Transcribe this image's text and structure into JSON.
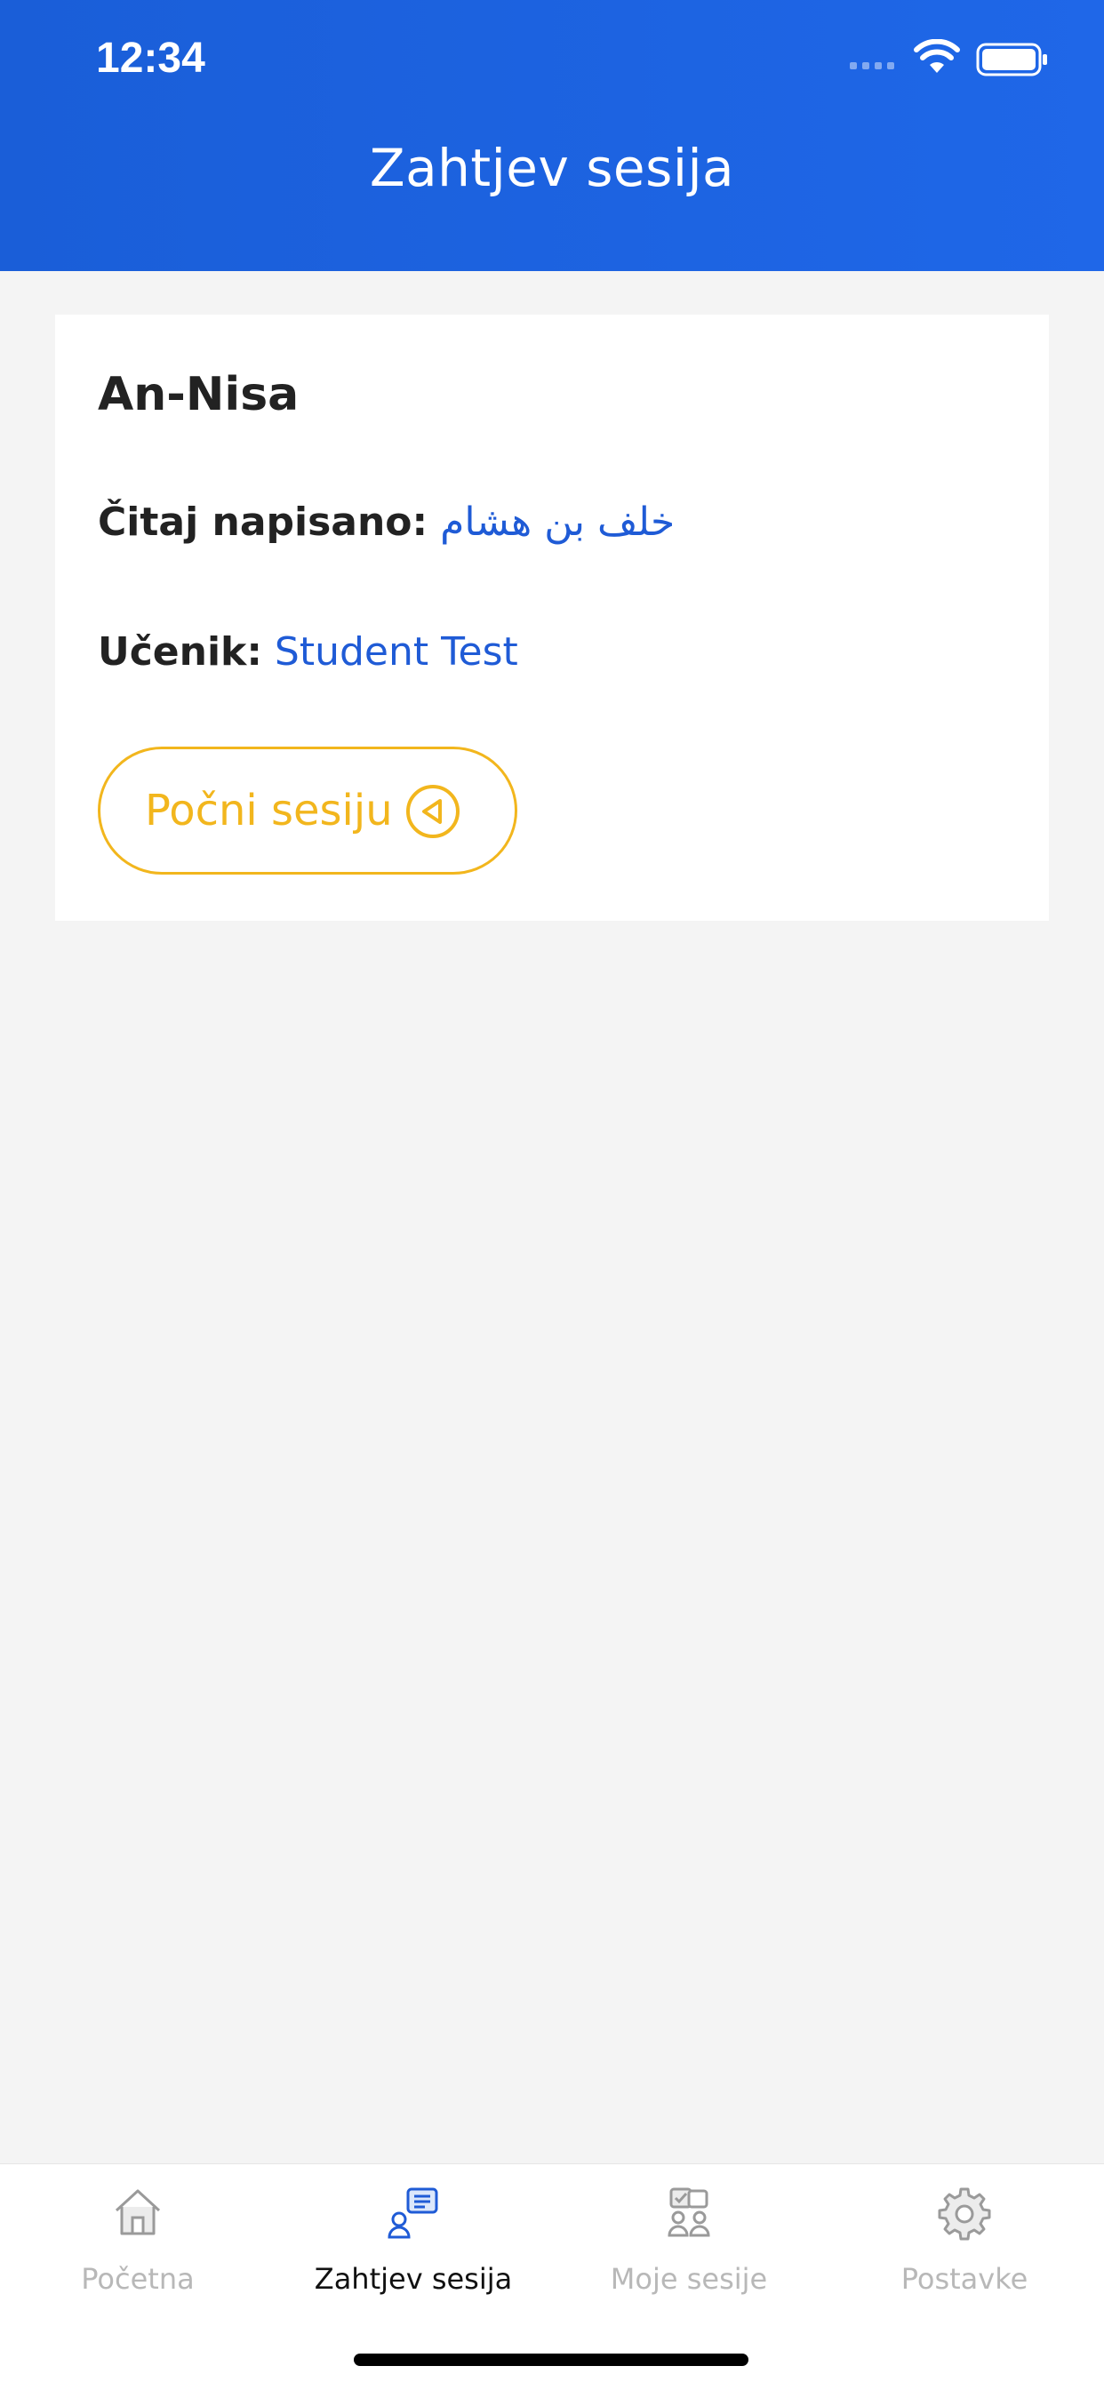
{
  "status_bar": {
    "time": "12:34"
  },
  "header": {
    "title": "Zahtjev sesija"
  },
  "card": {
    "title": "An-Nisa",
    "read_label": "Čitaj napisano:",
    "read_value": "خلف بن هشام",
    "student_label": "Učenik:",
    "student_value": "Student Test",
    "start_button": "Počni sesiju"
  },
  "tabbar": {
    "items": [
      {
        "label": "Početna",
        "icon": "home-icon",
        "active": false
      },
      {
        "label": "Zahtjev sesija",
        "icon": "request-chat-icon",
        "active": true
      },
      {
        "label": "Moje sesije",
        "icon": "my-sessions-icon",
        "active": false
      },
      {
        "label": "Postavke",
        "icon": "gear-icon",
        "active": false
      }
    ]
  },
  "colors": {
    "header_blue": "#1f67e8",
    "accent_yellow": "#f2b61d",
    "link_blue": "#1f5bd6",
    "inactive_gray": "#b8b8b8"
  }
}
